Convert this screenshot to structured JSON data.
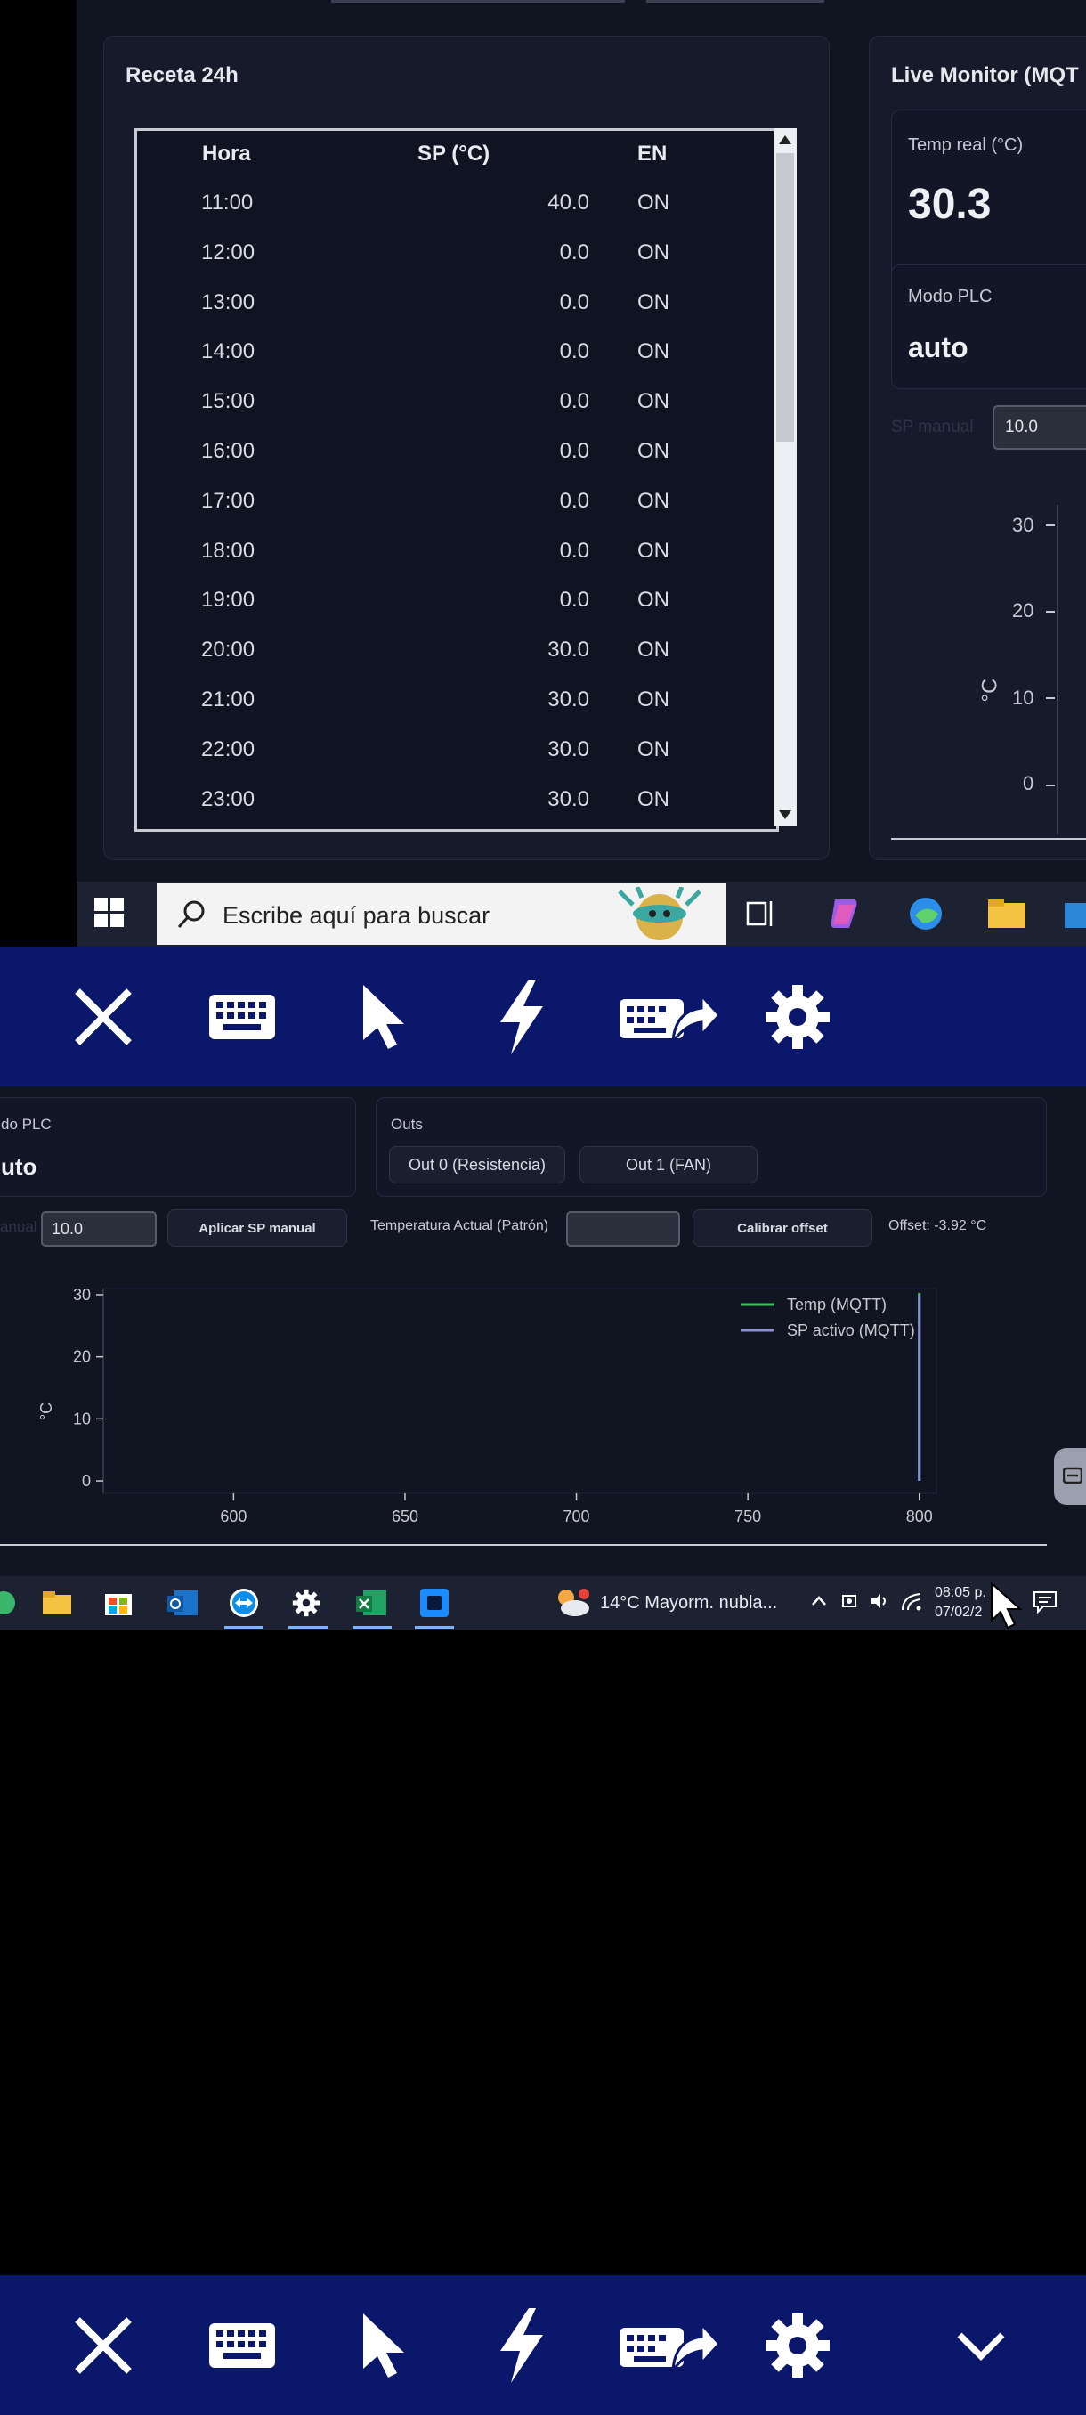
{
  "recipe": {
    "title": "Receta 24h",
    "headers": [
      "Hora",
      "SP (°C)",
      "EN"
    ],
    "rows": [
      {
        "hora": "11:00",
        "sp": "40.0",
        "en": "ON"
      },
      {
        "hora": "12:00",
        "sp": "0.0",
        "en": "ON"
      },
      {
        "hora": "13:00",
        "sp": "0.0",
        "en": "ON"
      },
      {
        "hora": "14:00",
        "sp": "0.0",
        "en": "ON"
      },
      {
        "hora": "15:00",
        "sp": "0.0",
        "en": "ON"
      },
      {
        "hora": "16:00",
        "sp": "0.0",
        "en": "ON"
      },
      {
        "hora": "17:00",
        "sp": "0.0",
        "en": "ON"
      },
      {
        "hora": "18:00",
        "sp": "0.0",
        "en": "ON"
      },
      {
        "hora": "19:00",
        "sp": "0.0",
        "en": "ON"
      },
      {
        "hora": "20:00",
        "sp": "30.0",
        "en": "ON"
      },
      {
        "hora": "21:00",
        "sp": "30.0",
        "en": "ON"
      },
      {
        "hora": "22:00",
        "sp": "30.0",
        "en": "ON"
      },
      {
        "hora": "23:00",
        "sp": "30.0",
        "en": "ON"
      }
    ]
  },
  "live_monitor": {
    "title": "Live Monitor (MQT",
    "temp_label": "Temp real (°C)",
    "temp_value": "30.3",
    "mode_label": "Modo PLC",
    "mode_value": "auto",
    "sp_manual_label": "SP manual",
    "sp_manual_value": "10.0",
    "ylabel": "°C",
    "ticks": [
      "30",
      "20",
      "10",
      "0"
    ]
  },
  "taskbar_top": {
    "search_placeholder": "Escribe aquí para buscar"
  },
  "toolbar": {
    "icons": [
      "close-icon",
      "keyboard-icon",
      "pointer-icon",
      "lightning-icon",
      "keyboard-send-icon",
      "gear-icon"
    ],
    "bottom_extra": "chevron-down-icon"
  },
  "lower": {
    "mode_label": "do PLC",
    "mode_value": "uto",
    "outs_label": "Outs",
    "out0": "Out 0 (Resistencia)",
    "out1": "Out 1 (FAN)",
    "sp_label": "anual",
    "sp_value": "10.0",
    "apply_button": "Aplicar SP manual",
    "temp_patron_label": "Temperatura Actual (Patrón)",
    "calibrate_button": "Calibrar offset",
    "offset_text": "Offset: -3.92 °C"
  },
  "chart_data": {
    "type": "line",
    "xlabel": "",
    "ylabel": "°C",
    "xlim": [
      562,
      805
    ],
    "ylim": [
      -2,
      31
    ],
    "x_ticks": [
      "600",
      "650",
      "700",
      "750",
      "800"
    ],
    "y_ticks": [
      "30",
      "20",
      "10",
      "0"
    ],
    "legend_position": "top-right",
    "series": [
      {
        "name": "Temp (MQTT)",
        "color": "#3fbf5f",
        "x": [
          800,
          800
        ],
        "y": [
          0,
          30.3
        ]
      },
      {
        "name": "SP activo (MQTT)",
        "color": "#8a8fd6",
        "x": [
          800,
          800
        ],
        "y": [
          0,
          30
        ]
      }
    ]
  },
  "taskbar_bottom": {
    "weather": "14°C  Mayorm. nubla...",
    "time": "08:05 p. m.",
    "date": "07/02/2"
  }
}
